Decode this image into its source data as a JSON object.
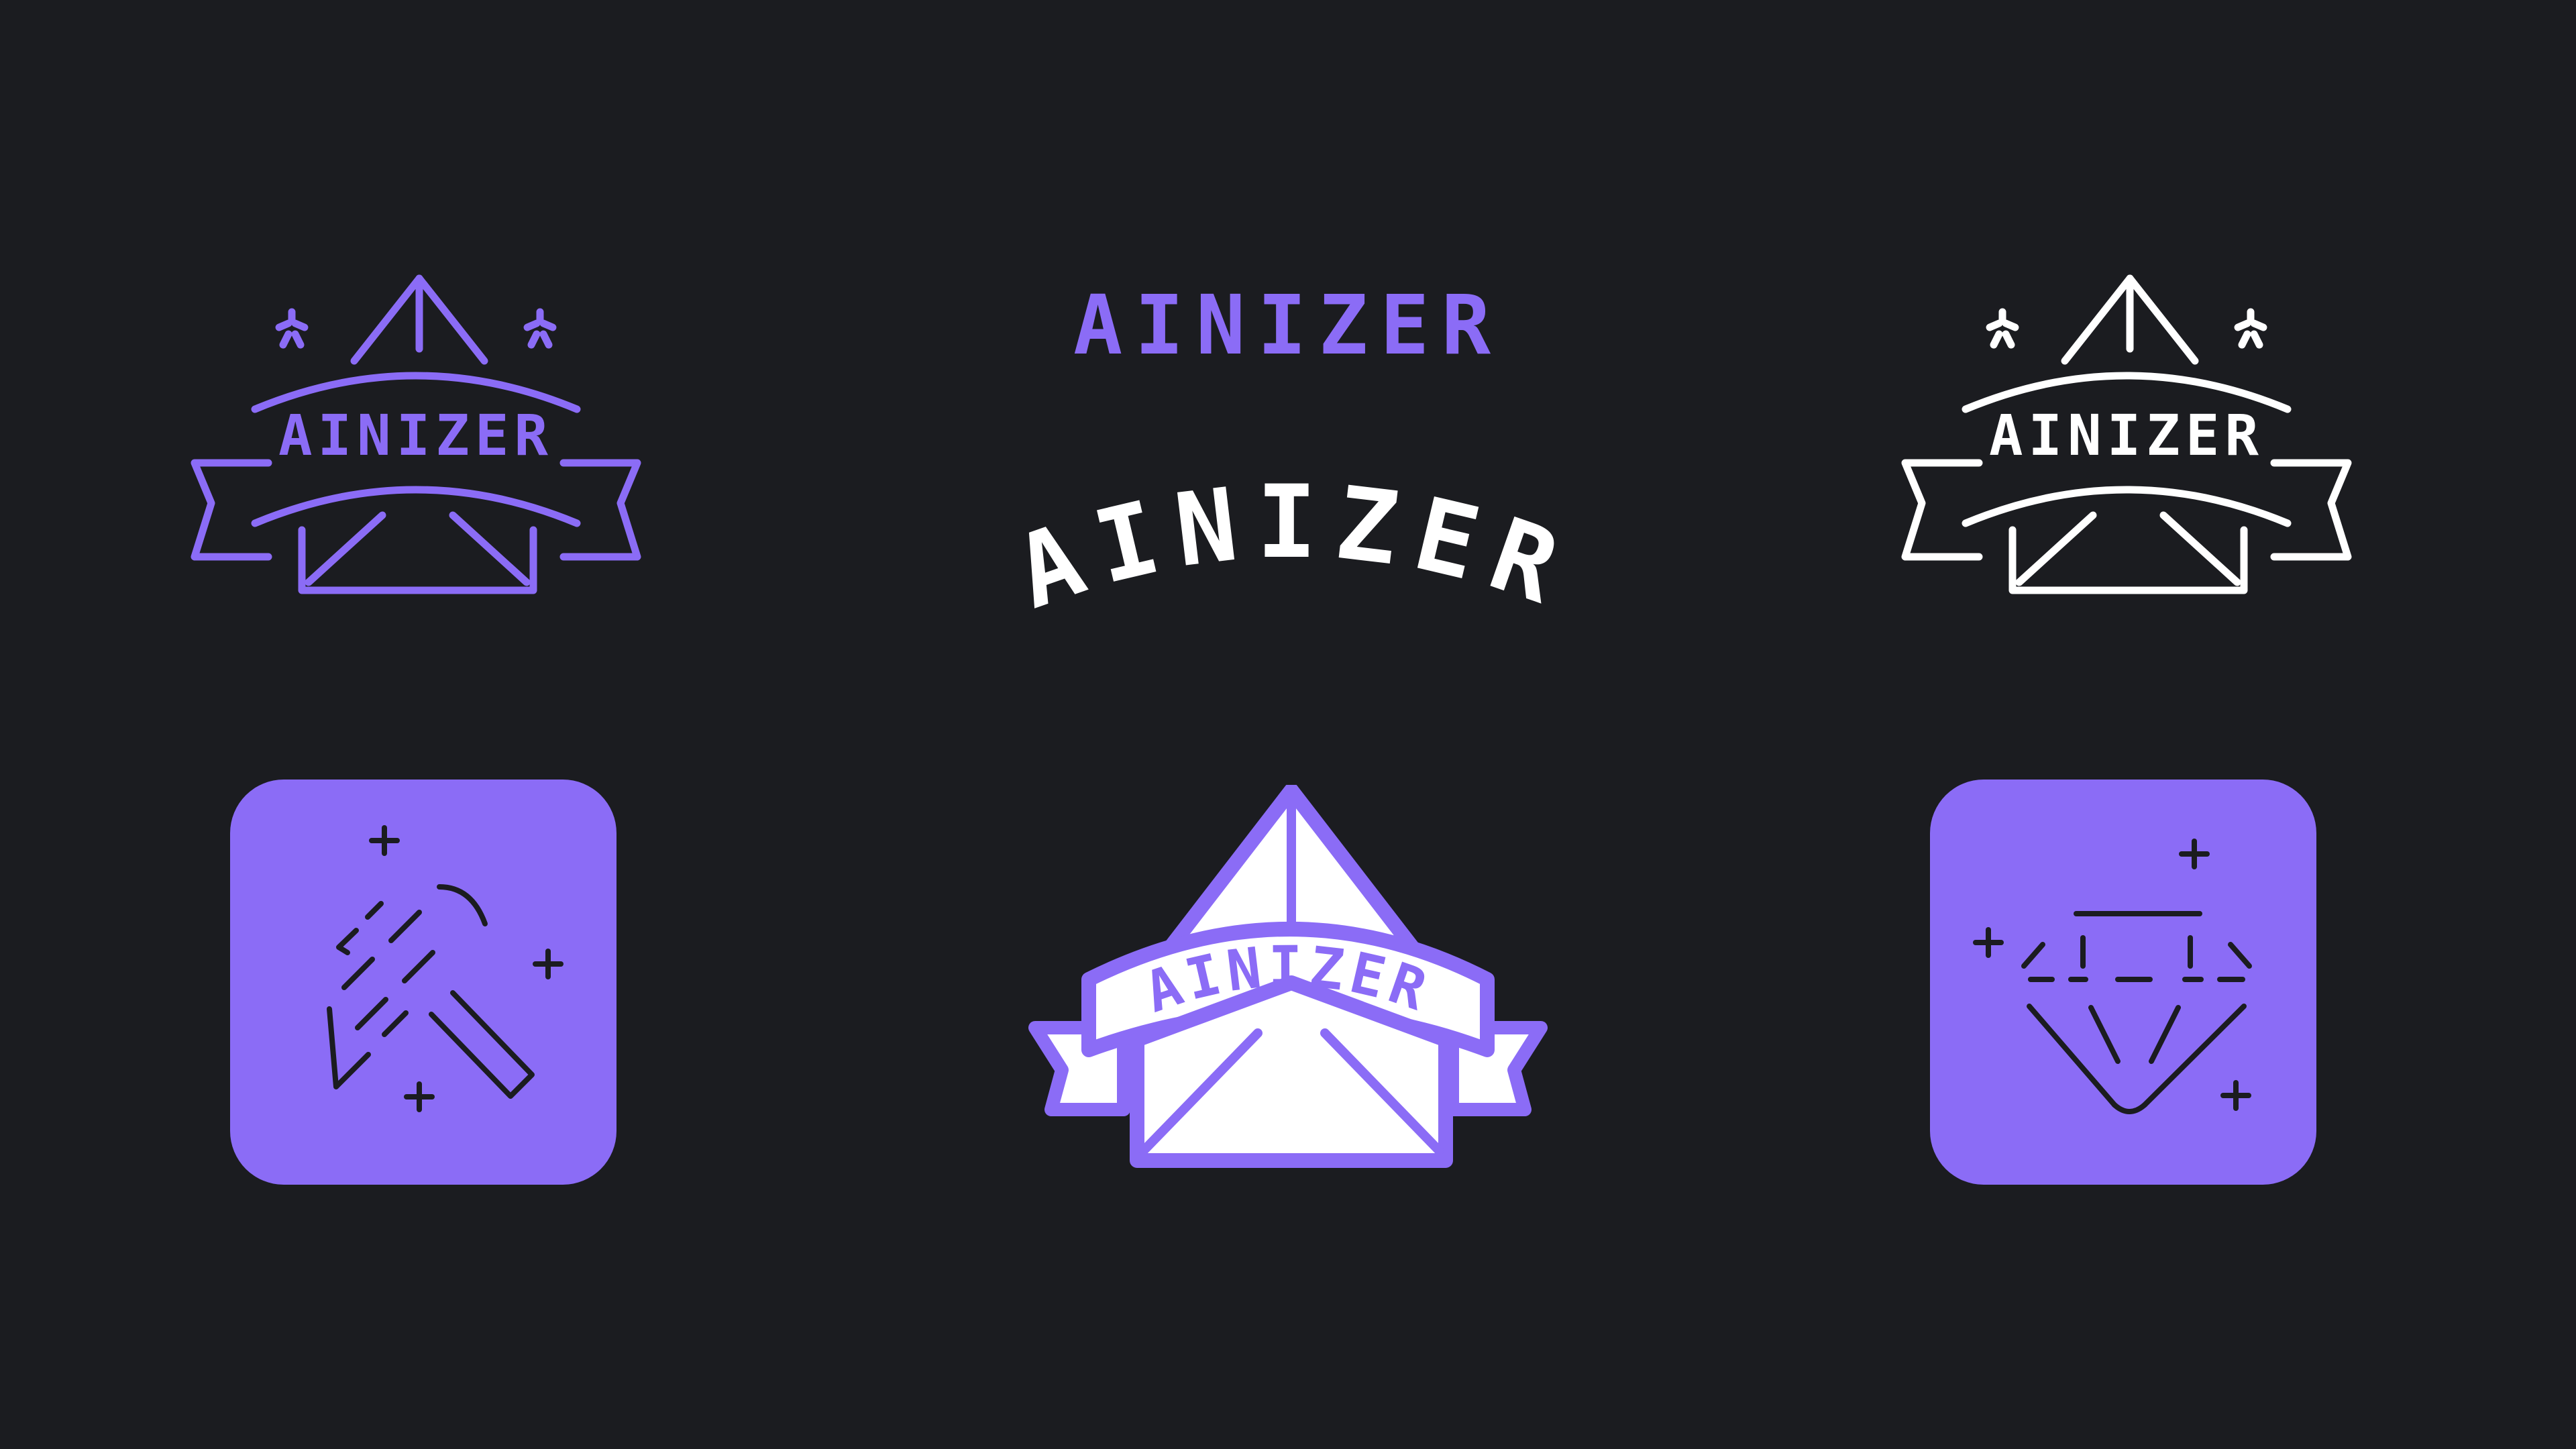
{
  "brand": {
    "name": "AINIZER",
    "wordmark_purple": "AINIZER",
    "wordmark_arched": "AINIZER"
  },
  "colors": {
    "background": "#1b1c20",
    "accent": "#8b6cf6",
    "white": "#ffffff",
    "dark_line": "#1b1c20"
  },
  "items": [
    {
      "icon": "tent-badge-outline-purple",
      "label": "AINIZER"
    },
    {
      "icon": "wordmark-purple",
      "label": "AINIZER"
    },
    {
      "icon": "wordmark-arched-white",
      "label": "AINIZER"
    },
    {
      "icon": "tent-badge-outline-white",
      "label": "AINIZER"
    },
    {
      "icon": "magic-wand-app-icon"
    },
    {
      "icon": "tent-badge-filled",
      "label": "AINIZER"
    },
    {
      "icon": "diamond-app-icon"
    }
  ]
}
